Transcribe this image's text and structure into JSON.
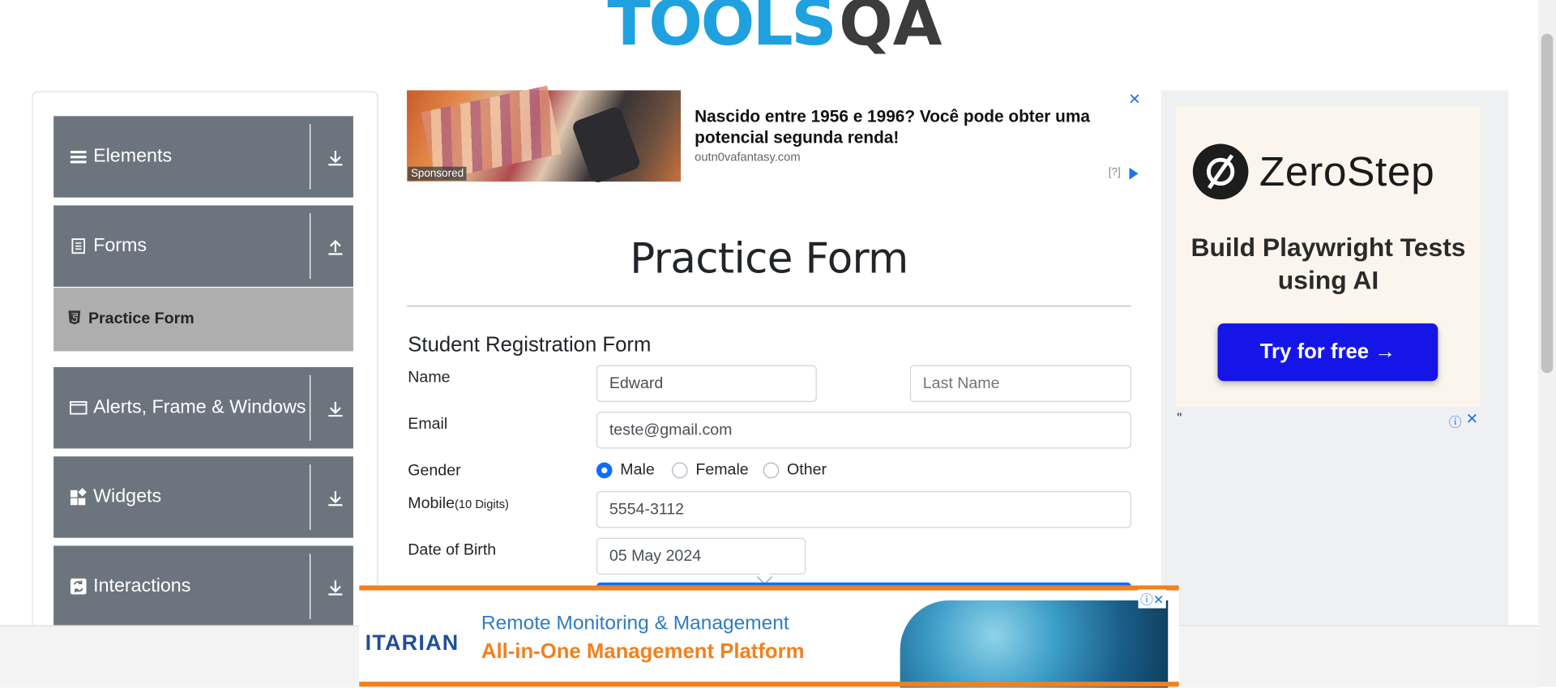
{
  "header": {
    "logo_tools": "TOOLS",
    "logo_qa": "QA"
  },
  "sidebar": {
    "groups": [
      {
        "label": "Elements",
        "icon": "hamburger-icon",
        "arrow": "download-arrow-icon"
      },
      {
        "label": "Forms",
        "icon": "document-icon",
        "arrow": "upload-arrow-icon"
      },
      {
        "label": "Alerts, Frame & Windows",
        "icon": "window-icon",
        "arrow": "download-arrow-icon"
      },
      {
        "label": "Widgets",
        "icon": "widgets-icon",
        "arrow": "download-arrow-icon"
      },
      {
        "label": "Interactions",
        "icon": "interactions-icon",
        "arrow": "download-arrow-icon"
      }
    ],
    "subitem": {
      "label": "Practice Form",
      "icon": "html5-icon"
    }
  },
  "ad_top": {
    "title": "Nascido entre 1956 e 1996? Você pode obter uma potencial segunda renda!",
    "domain": "outn0vafantasy.com",
    "sponsored": "Sponsored",
    "help": "[?]",
    "close": "✕"
  },
  "form": {
    "page_title": "Practice Form",
    "form_title": "Student Registration Form",
    "name_label": "Name",
    "first_name_value": "Edward",
    "last_name_placeholder": "Last Name",
    "email_label": "Email",
    "email_value": "teste@gmail.com",
    "gender_label": "Gender",
    "gender_options": [
      "Male",
      "Female",
      "Other"
    ],
    "gender_selected": "Male",
    "mobile_label": "Mobile",
    "mobile_hint": "(10 Digits)",
    "mobile_value": "5554-3112",
    "dob_label": "Date of Birth",
    "dob_value": "05 May 2024"
  },
  "ad_right": {
    "brand": "ZeroStep",
    "tagline": "Build Playwright Tests using AI",
    "cta": "Try for free →",
    "quote": "\"",
    "info": "ⓘ",
    "close": "✕"
  },
  "ad_bottom": {
    "logo": "ITARIAN",
    "line1": "Remote Monitoring & Management",
    "line2": "All-in-One Management Platform",
    "icons": "ⓘ✕"
  },
  "colors": {
    "sidebar_bg": "#6c757d",
    "subitem_bg": "#aeaeae",
    "accent_blue": "#0d6efd",
    "logo_blue": "#1fa1e0",
    "ad_orange": "#f2801f",
    "cta_blue": "#1515e8"
  }
}
